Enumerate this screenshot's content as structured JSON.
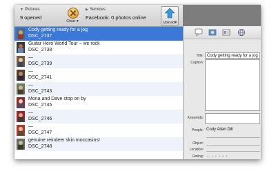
{
  "toolbar": {
    "pictures_header": "Pictures",
    "pictures_value": "9 opened",
    "clear_label": "Clear",
    "services_header": "Services",
    "services_value": "Facebook: 0 photos online",
    "upload_label": "Upload"
  },
  "photos": [
    {
      "title": "Cody getting ready for a jog",
      "file": "DSC_2737",
      "selected": true
    },
    {
      "title": "Guitar Hero World Tour – we rock",
      "file": "DSC_2738"
    },
    {
      "title": "—",
      "file": "DSC_2739"
    },
    {
      "title": "—",
      "file": "DSC_2741"
    },
    {
      "title": "—",
      "file": "DSC_2743"
    },
    {
      "title": "Mona and Dave stop on by",
      "file": "DSC_2745"
    },
    {
      "title": "—",
      "file": "DSC_2746"
    },
    {
      "title": "—",
      "file": "DSC_2747"
    },
    {
      "title": "genuine reindeer skin moccasins!",
      "file": "DSC_2748"
    }
  ],
  "detail": {
    "title_label": "Title:",
    "title_value": "Cody getting ready for a jog",
    "caption_label": "Caption:",
    "keywords_label": "Keywords:",
    "people_label": "People:",
    "people_value": "Cody Allan Dill",
    "object_label": "Object:",
    "location_label": "Location:",
    "rating_label": "Rating:",
    "rating_stars": "☆ • • • • •"
  },
  "icons": [
    "speech-bubble-icon",
    "photo-icon",
    "address-card-icon",
    "globe-icon",
    "upload-arrow-icon",
    "clear-icon"
  ],
  "colors": {
    "selection": "#3b78d8",
    "alt_row": "#eef3fb"
  }
}
